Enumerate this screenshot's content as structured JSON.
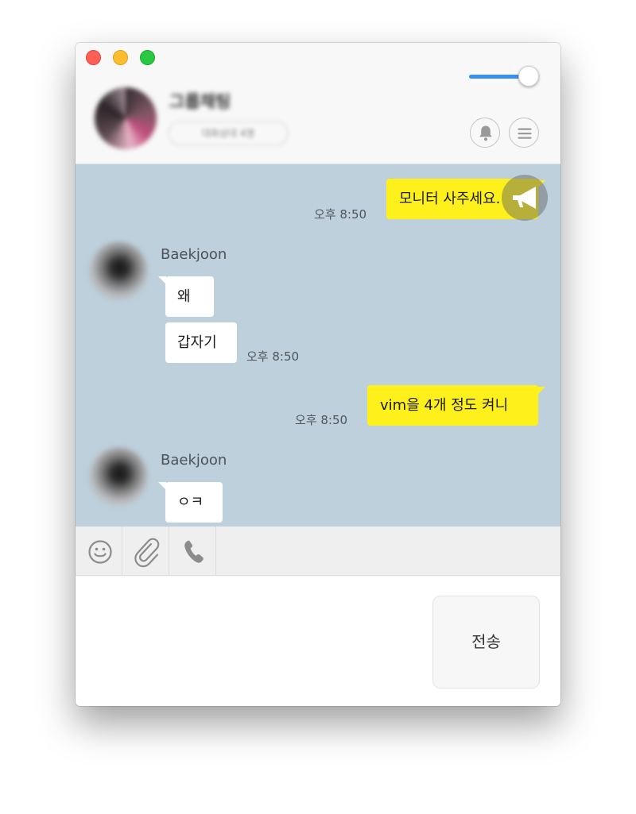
{
  "header": {
    "group_name": "그룹채팅",
    "member_info": "대화상대 4명"
  },
  "chat": {
    "messages": [
      {
        "text": "모니터 사주세요.",
        "time": "오후 8:50"
      },
      {
        "sender": "Baekjoon",
        "text": "왜"
      },
      {
        "text": "갑자기",
        "time": "오후 8:50"
      },
      {
        "text": "vim을 4개 정도 켜니",
        "time": "오후 8:50"
      },
      {
        "sender": "Baekjoon",
        "text": "ㅇㅋ"
      }
    ]
  },
  "toolbar": {
    "icons": [
      "emoji-icon",
      "attachment-icon",
      "phone-icon"
    ]
  },
  "input": {
    "value": "",
    "send_label": "전송"
  },
  "colors": {
    "chat_background": "#bdd0dc",
    "my_bubble": "#fef01b",
    "their_bubble": "#ffffff",
    "slider_accent": "#3a8ff2"
  }
}
